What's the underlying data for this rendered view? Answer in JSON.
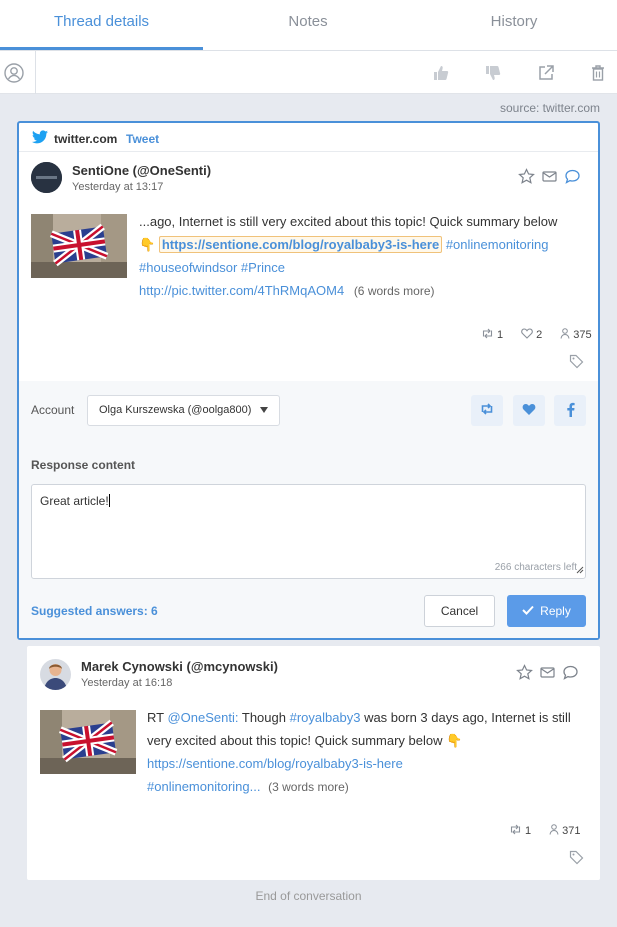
{
  "tabs": [
    {
      "label": "Thread details",
      "active": true
    },
    {
      "label": "Notes",
      "active": false
    },
    {
      "label": "History",
      "active": false
    }
  ],
  "source": "source: twitter.com",
  "active_post": {
    "site": "twitter.com",
    "kind": "Tweet",
    "author": "SentiOne (@OneSenti)",
    "time": "Yesterday at 13:17",
    "text": {
      "lead": "...ago, Internet is still very excited about this topic! Quick summary below",
      "emoji": "👇",
      "url": "https://sentione.com/blog/royalbaby3-is-here",
      "tag1": "#onlinemonitoring",
      "tag2": "#houseofwindsor",
      "tag3": "#Prince",
      "pic": "http://pic.twitter.com/4ThRMqAOM4",
      "more": "(6 words more)"
    },
    "stats": {
      "retweets": "1",
      "likes": "2",
      "reach": "375"
    }
  },
  "response": {
    "account_label": "Account",
    "account_value": "Olga Kurszewska (@oolga800)",
    "content_label": "Response content",
    "content_value": "Great article!",
    "chars_left": "266 characters left",
    "suggested": "Suggested answers: 6",
    "cancel": "Cancel",
    "reply": "Reply"
  },
  "second_post": {
    "author": "Marek Cynowski (@mcynowski)",
    "time": "Yesterday at 16:18",
    "text": {
      "rt": "RT",
      "mention": "@OneSenti:",
      "t1": "Though",
      "tag": "#royalbaby3",
      "t2": "was born 3 days ago, Internet is still very excited about this topic! Quick summary below",
      "emoji": "👇",
      "url": "https://sentione.com/blog/royalbaby3-is-here",
      "tag2": "#onlinemonitoring...",
      "more": "(3 words more)"
    },
    "stats": {
      "retweets": "1",
      "reach": "371"
    }
  },
  "footer": "End of conversation",
  "colors": {
    "accent": "#4a90d9",
    "reply_button": "#5b9be8",
    "background": "#e7eaf0"
  }
}
